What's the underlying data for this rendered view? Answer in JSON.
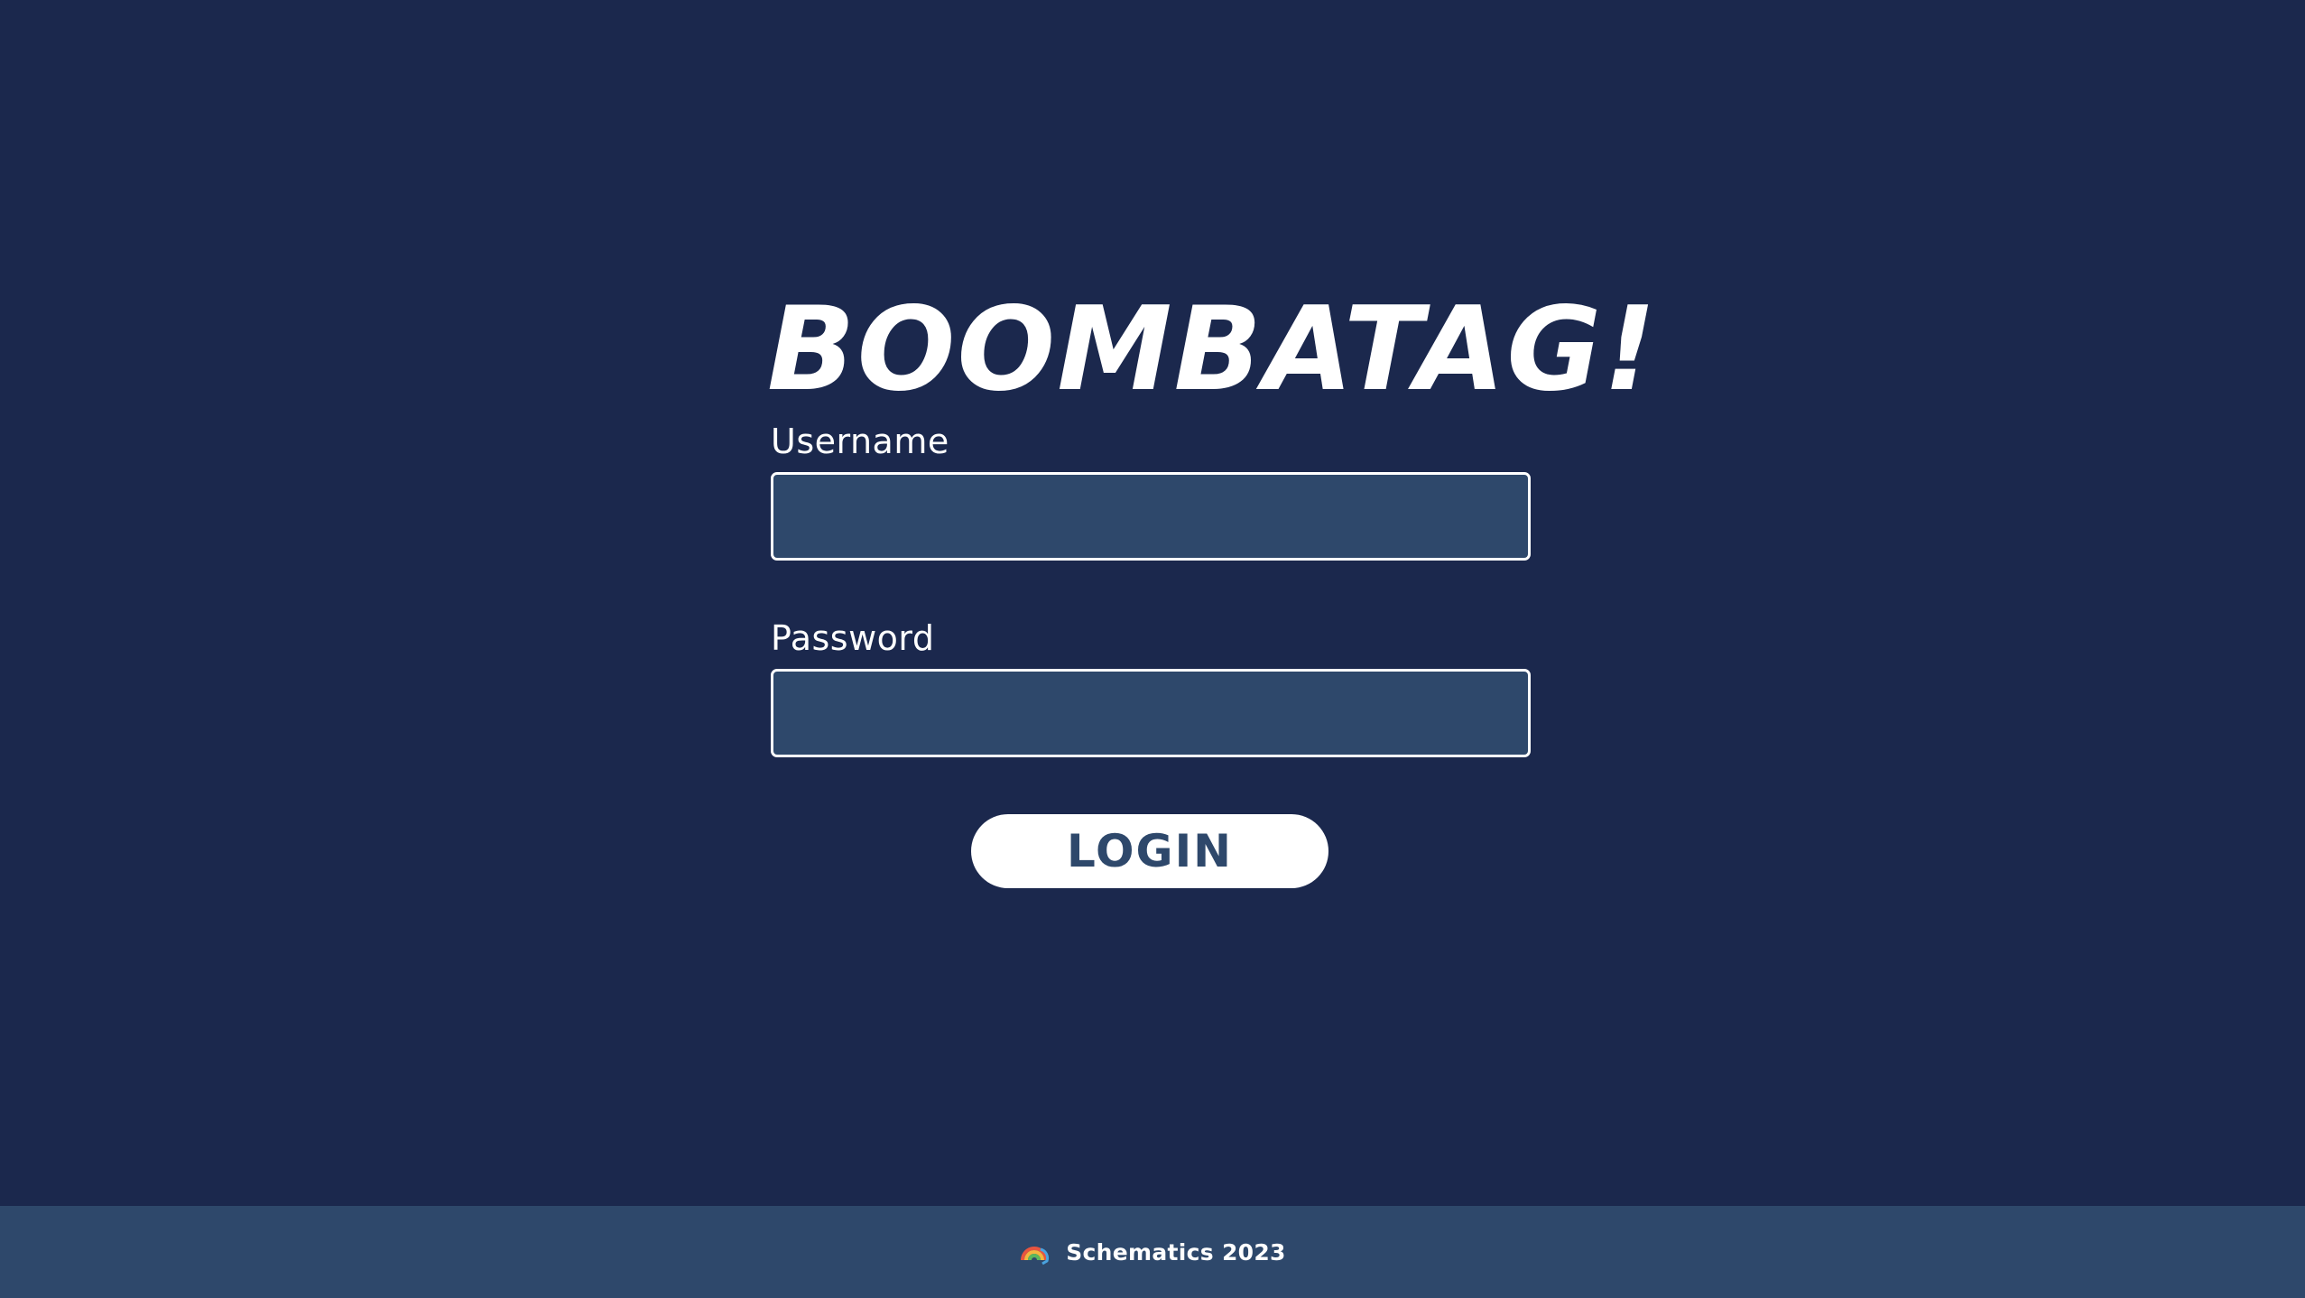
{
  "app": {
    "logo_text": "BOOMBATAG!"
  },
  "form": {
    "username_label": "Username",
    "username_value": "",
    "password_label": "Password",
    "password_value": "",
    "login_label": "LOGIN"
  },
  "footer": {
    "text": "Schematics 2023",
    "logo_icon": "rainbow-logo-icon"
  },
  "colors": {
    "background": "#1b284d",
    "input_background": "#2e486b",
    "footer_background": "#2e486b",
    "button_background": "#ffffff",
    "button_text": "#2e486b",
    "text": "#ffffff"
  }
}
